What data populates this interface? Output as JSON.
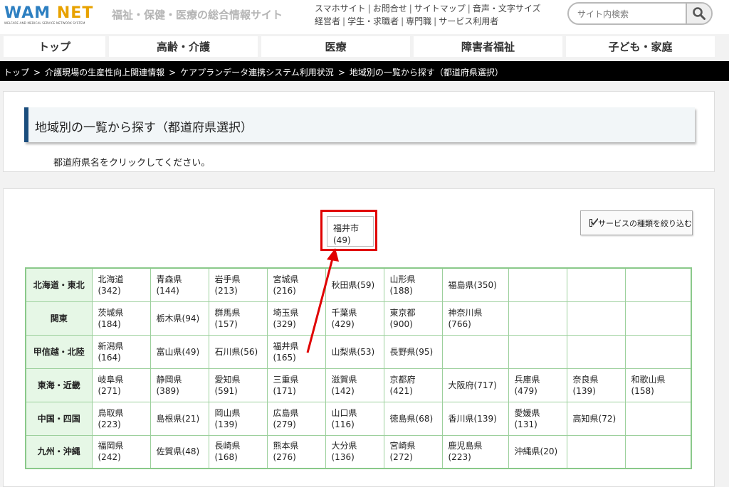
{
  "header": {
    "logo_text_a": "WAM",
    "logo_text_b": "NET",
    "logo_subtitle": "WELFARE AND MEDICAL SERVICE NETWORK SYSTEM",
    "tagline": "福祉・保健・医療の総合情報サイト",
    "links_row1": [
      "スマホサイト",
      "お問合せ",
      "サイトマップ",
      "音声・文字サイズ"
    ],
    "links_row2": [
      "経営者",
      "学生・求職者",
      "専門職",
      "サービス利用者"
    ],
    "search_placeholder": "サイト内検索"
  },
  "nav": {
    "tabs": [
      "トップ",
      "高齢・介護",
      "医療",
      "障害者福祉",
      "子ども・家庭"
    ]
  },
  "breadcrumb": [
    "トップ",
    "介護現場の生産性向上関連情報",
    "ケアプランデータ連携システム利用状況",
    "地域別の一覧から探す（都道府県選択）"
  ],
  "page": {
    "title": "地域別の一覧から探す（都道府県選択）",
    "instruction": "都道府県名をクリックしてください。",
    "filter_button": "サービスの種類を絞り込む",
    "popup": {
      "name": "福井市",
      "count": "(49)"
    }
  },
  "regions": [
    {
      "name": "北海道・東北",
      "prefs": [
        {
          "name": "北海道",
          "count": "(342)",
          "wrap": true
        },
        {
          "name": "青森県",
          "count": "(144)",
          "wrap": true
        },
        {
          "name": "岩手県",
          "count": "(213)",
          "wrap": true
        },
        {
          "name": "宮城県",
          "count": "(216)",
          "wrap": true
        },
        {
          "name": "秋田県",
          "count": "(59)",
          "wrap": false
        },
        {
          "name": "山形県",
          "count": "(188)",
          "wrap": true
        },
        {
          "name": "福島県",
          "count": "(350)",
          "wrap": false
        }
      ]
    },
    {
      "name": "関東",
      "prefs": [
        {
          "name": "茨城県",
          "count": "(184)",
          "wrap": true
        },
        {
          "name": "栃木県",
          "count": "(94)",
          "wrap": false
        },
        {
          "name": "群馬県",
          "count": "(157)",
          "wrap": true
        },
        {
          "name": "埼玉県",
          "count": "(329)",
          "wrap": true
        },
        {
          "name": "千葉県",
          "count": "(429)",
          "wrap": true
        },
        {
          "name": "東京都",
          "count": "(900)",
          "wrap": true
        },
        {
          "name": "神奈川県",
          "count": "(766)",
          "wrap": true
        }
      ]
    },
    {
      "name": "甲信越・北陸",
      "prefs": [
        {
          "name": "新潟県",
          "count": "(164)",
          "wrap": true
        },
        {
          "name": "富山県",
          "count": "(49)",
          "wrap": false
        },
        {
          "name": "石川県",
          "count": "(56)",
          "wrap": false
        },
        {
          "name": "福井県",
          "count": "(165)",
          "wrap": true
        },
        {
          "name": "山梨県",
          "count": "(53)",
          "wrap": false
        },
        {
          "name": "長野県",
          "count": "(95)",
          "wrap": false
        }
      ]
    },
    {
      "name": "東海・近畿",
      "prefs": [
        {
          "name": "岐阜県",
          "count": "(271)",
          "wrap": true
        },
        {
          "name": "静岡県",
          "count": "(389)",
          "wrap": true
        },
        {
          "name": "愛知県",
          "count": "(591)",
          "wrap": true
        },
        {
          "name": "三重県",
          "count": "(171)",
          "wrap": true
        },
        {
          "name": "滋賀県",
          "count": "(142)",
          "wrap": true
        },
        {
          "name": "京都府",
          "count": "(421)",
          "wrap": true
        },
        {
          "name": "大阪府",
          "count": "(717)",
          "wrap": false
        },
        {
          "name": "兵庫県",
          "count": "(479)",
          "wrap": true
        },
        {
          "name": "奈良県",
          "count": "(139)",
          "wrap": true
        },
        {
          "name": "和歌山県",
          "count": "(158)",
          "wrap": true
        }
      ]
    },
    {
      "name": "中国・四国",
      "prefs": [
        {
          "name": "鳥取県",
          "count": "(223)",
          "wrap": true
        },
        {
          "name": "島根県",
          "count": "(21)",
          "wrap": false
        },
        {
          "name": "岡山県",
          "count": "(139)",
          "wrap": true
        },
        {
          "name": "広島県",
          "count": "(279)",
          "wrap": true
        },
        {
          "name": "山口県",
          "count": "(116)",
          "wrap": true
        },
        {
          "name": "徳島県",
          "count": "(68)",
          "wrap": false
        },
        {
          "name": "香川県",
          "count": "(139)",
          "wrap": false
        },
        {
          "name": "愛媛県",
          "count": "(131)",
          "wrap": true
        },
        {
          "name": "高知県",
          "count": "(72)",
          "wrap": false
        }
      ]
    },
    {
      "name": "九州・沖縄",
      "prefs": [
        {
          "name": "福岡県",
          "count": "(242)",
          "wrap": true
        },
        {
          "name": "佐賀県",
          "count": "(48)",
          "wrap": false
        },
        {
          "name": "長崎県",
          "count": "(168)",
          "wrap": true
        },
        {
          "name": "熊本県",
          "count": "(276)",
          "wrap": true
        },
        {
          "name": "大分県",
          "count": "(136)",
          "wrap": true
        },
        {
          "name": "宮崎県",
          "count": "(272)",
          "wrap": true
        },
        {
          "name": "鹿児島県",
          "count": "(223)",
          "wrap": true
        },
        {
          "name": "沖縄県",
          "count": "(20)",
          "wrap": false
        }
      ]
    }
  ],
  "colors": {
    "highlight": "#e00000",
    "table_border": "#8ac98a",
    "region_bg": "#e6f7e6",
    "title_accent": "#1a4d7d",
    "logo_blue": "#2d7fc1",
    "logo_orange": "#e8a200"
  }
}
